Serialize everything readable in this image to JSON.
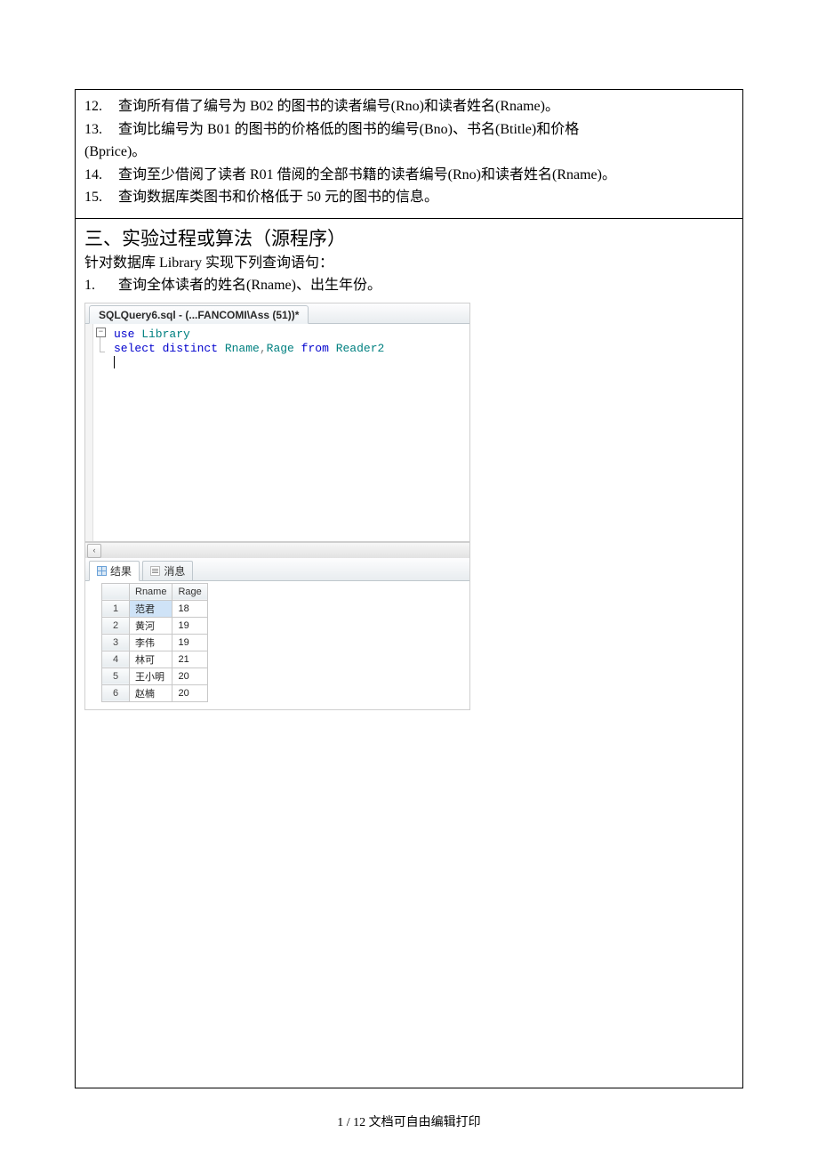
{
  "questions": [
    {
      "num": "12.",
      "text": "查询所有借了编号为 B02 的图书的读者编号(Rno)和读者姓名(Rname)。"
    },
    {
      "num": "13.",
      "text": "查询比编号为 B01 的图书的价格低的图书的编号(Bno)、书名(Btitle)和价格",
      "cont": "(Bprice)。"
    },
    {
      "num": "14.",
      "text": "查询至少借阅了读者 R01 借阅的全部书籍的读者编号(Rno)和读者姓名(Rname)。"
    },
    {
      "num": "15.",
      "text": "查询数据库类图书和价格低于 50 元的图书的信息。"
    }
  ],
  "section_title": "三、实验过程或算法（源程序）",
  "section_intro": "针对数据库 Library 实现下列查询语句：",
  "sub_q": {
    "num": "1.",
    "text": "查询全体读者的姓名(Rname)、出生年份。"
  },
  "sql_tab": "SQLQuery6.sql - (...FANCOMI\\Ass (51))*",
  "code": {
    "l1a": "use",
    "l1b": " Library",
    "l2a": "select",
    "l2b": " distinct",
    "l2c": " Rname",
    "l2d": ",",
    "l2e": "Rage ",
    "l2f": "from",
    "l2g": " Reader2"
  },
  "result_tabs": {
    "results": "结果",
    "messages": "消息"
  },
  "grid": {
    "cols": [
      "Rname",
      "Rage"
    ],
    "rows": [
      {
        "n": "1",
        "c": [
          "范君",
          "18"
        ],
        "sel": true
      },
      {
        "n": "2",
        "c": [
          "黄河",
          "19"
        ]
      },
      {
        "n": "3",
        "c": [
          "李伟",
          "19"
        ]
      },
      {
        "n": "4",
        "c": [
          "林可",
          "21"
        ]
      },
      {
        "n": "5",
        "c": [
          "王小明",
          "20"
        ]
      },
      {
        "n": "6",
        "c": [
          "赵楠",
          "20"
        ]
      }
    ]
  },
  "footer": "1 / 12 文档可自由编辑打印"
}
